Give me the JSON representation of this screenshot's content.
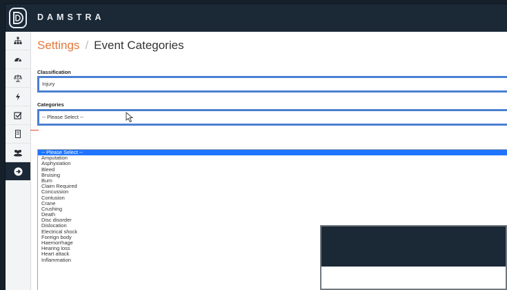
{
  "app": {
    "brand": "DAMSTRA"
  },
  "breadcrumb": {
    "parent": "Settings",
    "separator": "/",
    "current": "Event Categories"
  },
  "form": {
    "classification": {
      "label": "Classification",
      "value": "Injury"
    },
    "categories": {
      "label": "Categories",
      "value": "-- Please Select --",
      "options": [
        "-- Please Select --",
        "Amputation",
        "Asphyxiation",
        "Bleed",
        "Bruising",
        "Burn",
        "Claim Required",
        "Concussion",
        "Contusion",
        "Crane",
        "Crushing",
        "Death",
        "Disc disorder",
        "Dislocation",
        "Electrical shock",
        "Foreign body",
        "Haemorrhage",
        "Hearing loss",
        "Heart attack",
        "Inflammation"
      ]
    }
  },
  "sidebar": {
    "icons": [
      "sitemap-icon",
      "dashboard-icon",
      "scales-icon",
      "bolt-icon",
      "checkbox-icon",
      "building-icon",
      "users-icon",
      "arrow-right-circle-icon"
    ]
  },
  "colors": {
    "topbar": "#1b2836",
    "accent": "#e3773a",
    "focus_border": "#4a7fd1",
    "selected_option": "#1e74ff"
  }
}
